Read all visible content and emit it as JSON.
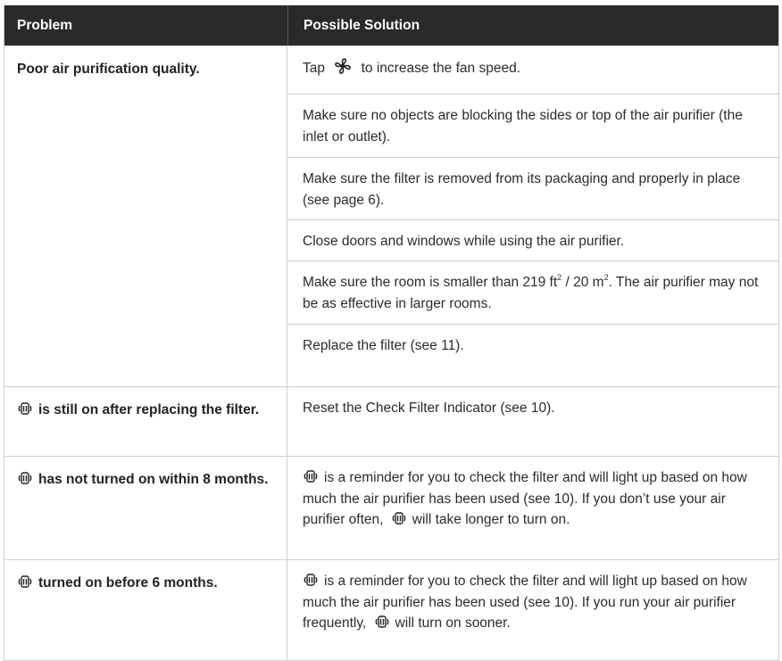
{
  "header": {
    "problem": "Problem",
    "solution": "Possible Solution"
  },
  "rows": [
    {
      "problem": "Poor air purification quality.",
      "solutions": [
        {
          "before": "Tap",
          "icon": "fan-icon",
          "after": "to increase the fan speed."
        },
        {
          "text": "Make sure no objects are blocking the sides or top of the air purifier (the inlet or outlet)."
        },
        {
          "text": "Make sure the filter is removed from its packaging and properly in place (see page 6)."
        },
        {
          "text": "Close doors and windows while using the air purifier."
        },
        {
          "before": "Make sure the room is smaller than 219 ft",
          "sup1": "2",
          "mid": " / 20 m",
          "sup2": "2",
          "after": ". The air purifier may not be as effective in larger rooms."
        },
        {
          "text": "Replace the filter (see 11)."
        }
      ]
    },
    {
      "problem_icon": "check-filter-icon",
      "problem": "is still on after replacing the filter.",
      "solutions": [
        {
          "text": "Reset the Check Filter Indicator (see 10)."
        }
      ]
    },
    {
      "problem_icon": "check-filter-icon",
      "problem": "has not turned on within 8 months.",
      "solutions": [
        {
          "part1": "is a reminder for you to check the filter and will light up based on how much the air purifier has been used (see 10). If you don’t use your air purifier often,",
          "part2": "will take longer to turn on."
        }
      ]
    },
    {
      "problem_icon": "check-filter-icon",
      "problem": "turned on before 6 months.",
      "solutions": [
        {
          "part1": "is a reminder for you to check the filter and will light up based on how much the air purifier has been used (see 10). If you run your air purifier frequently,",
          "part2": "will turn on sooner."
        }
      ]
    }
  ]
}
